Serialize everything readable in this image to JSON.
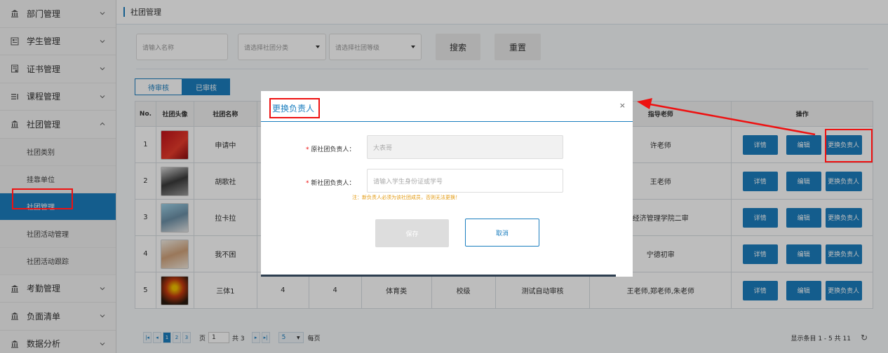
{
  "sidebar": {
    "items": [
      {
        "label": "部门管理",
        "icon": "building-icon",
        "expanded": false
      },
      {
        "label": "学生管理",
        "icon": "student-icon",
        "expanded": false
      },
      {
        "label": "证书管理",
        "icon": "certificate-icon",
        "expanded": false
      },
      {
        "label": "课程管理",
        "icon": "course-icon",
        "expanded": false
      },
      {
        "label": "社团管理",
        "icon": "building-icon",
        "expanded": true
      }
    ],
    "sub_items": [
      {
        "label": "社团类别"
      },
      {
        "label": "挂靠单位"
      },
      {
        "label": "社团管理",
        "active": true
      },
      {
        "label": "社团活动管理"
      },
      {
        "label": "社团活动跟踪"
      }
    ],
    "bottom_items": [
      {
        "label": "考勤管理",
        "icon": "building-icon"
      },
      {
        "label": "负面清单",
        "icon": "building-icon"
      },
      {
        "label": "数据分析",
        "icon": "building-icon"
      }
    ]
  },
  "header": {
    "title": "社团管理"
  },
  "filters": {
    "name_placeholder": "请输入名称",
    "category_placeholder": "请选择社团分类",
    "level_placeholder": "请选择社团等级",
    "search_label": "搜索",
    "reset_label": "重置"
  },
  "tabs": [
    {
      "label": "待审核",
      "active": false
    },
    {
      "label": "已审核",
      "active": true
    }
  ],
  "table": {
    "headers": [
      "No.",
      "社团头像",
      "社团名称",
      "",
      "",
      "",
      "",
      "",
      "指导老师",
      "操作"
    ],
    "rows": [
      {
        "no": "1",
        "name": "申请中",
        "c4": "",
        "c5": "",
        "c6": "",
        "c7": "",
        "c8": "",
        "teacher": "许老师"
      },
      {
        "no": "2",
        "name": "胡歌社",
        "c4": "",
        "c5": "",
        "c6": "",
        "c7": "",
        "c8": "",
        "teacher": "王老师"
      },
      {
        "no": "3",
        "name": "拉卡拉",
        "c4": "",
        "c5": "",
        "c6": "",
        "c7": "",
        "c8": "",
        "teacher": "经济管理学院二审"
      },
      {
        "no": "4",
        "name": "我不困",
        "c4": "",
        "c5": "",
        "c6": "",
        "c7": "",
        "c8": "",
        "teacher": "宁德初审"
      },
      {
        "no": "5",
        "name": "三体1",
        "c4": "4",
        "c5": "4",
        "c6": "体育类",
        "c7": "校级",
        "c8": "测试自动审核",
        "teacher": "王老师,郑老师,朱老师"
      }
    ],
    "op_labels": {
      "detail": "详情",
      "edit": "编辑",
      "change": "更换负责人"
    }
  },
  "pager": {
    "pages": [
      "1",
      "2",
      "3"
    ],
    "current_page": "1",
    "page_label": "页",
    "page_input": "1",
    "total_pages_label": "共 3",
    "page_size": "5",
    "per_page_label": "每页",
    "summary": "显示条目 1 - 5 共 11"
  },
  "modal": {
    "title": "更换负责人",
    "close": "×",
    "old_label": "原社团负责人：",
    "old_value": "大表哥",
    "new_label": "新社团负责人：",
    "new_placeholder": "请输入学生身份证或学号",
    "note": "注：新负责人必须为该社团成员，否则无法更换！",
    "required_mark": "*",
    "save_label": "保存",
    "cancel_label": "取消"
  },
  "colors": {
    "primary": "#1b7ebf",
    "highlight": "#ee1111",
    "sidebar_bg": "#f4f4f4"
  }
}
